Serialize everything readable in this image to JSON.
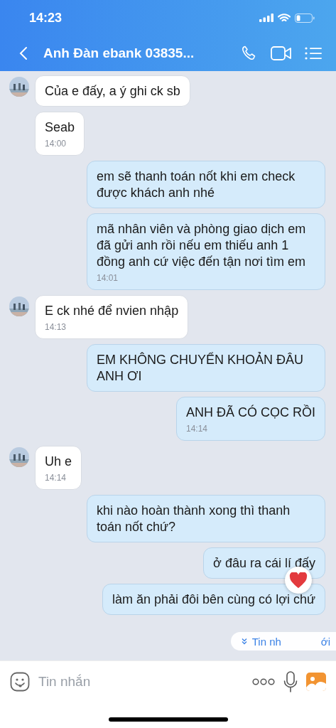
{
  "status_bar": {
    "time": "14:23"
  },
  "header": {
    "title": "Anh Đàn ebank 03835..."
  },
  "messages": [
    {
      "kind": "incoming",
      "avatar": true,
      "text": "Của e đấy, a ý ghi ck sb"
    },
    {
      "kind": "incoming",
      "avatar": false,
      "text": "Seab",
      "time": "14:00"
    },
    {
      "kind": "outgoing",
      "text": "em sẽ thanh toán nốt khi em check được khách anh nhé"
    },
    {
      "kind": "outgoing",
      "text": "mã nhân viên và phòng giao dịch em đã gửi anh rồi nếu em thiếu anh 1 đồng anh cứ việc đến tận nơi tìm em",
      "time": "14:01"
    },
    {
      "kind": "incoming",
      "avatar": true,
      "text": "E ck nhé để nvien nhập",
      "time": "14:13"
    },
    {
      "kind": "outgoing",
      "text": "EM KHÔNG CHUYỂN KHOẢN ĐÂU ANH ƠI"
    },
    {
      "kind": "outgoing",
      "text": "ANH ĐÃ CÓ CỌC RỒI",
      "time": "14:14"
    },
    {
      "kind": "incoming",
      "avatar": true,
      "text": "Uh e",
      "time": "14:14"
    },
    {
      "kind": "outgoing",
      "text": "khi nào hoàn thành xong thì thanh toán nốt chứ?"
    },
    {
      "kind": "outgoing",
      "text": "ở đâu ra cái lí đấy",
      "reaction": true
    },
    {
      "kind": "outgoing",
      "text": "làm ăn phải đôi bên cùng có lợi chứ"
    }
  ],
  "new_messages_pill": {
    "label_start": "Tin nh",
    "label_end": "ới"
  },
  "composer": {
    "placeholder": "Tin nhắn"
  }
}
